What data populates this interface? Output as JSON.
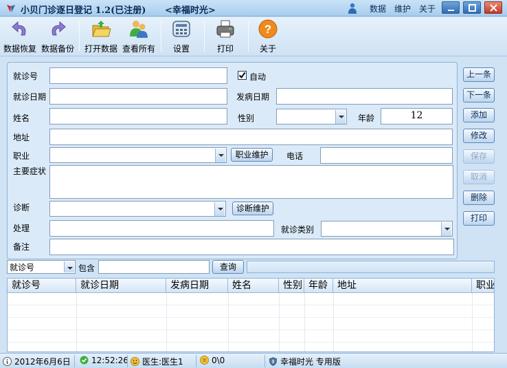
{
  "window": {
    "title": "小贝门诊逐日登记 1.2(已注册)",
    "subtitle": "<幸福时光>",
    "menu": [
      "数据",
      "维护",
      "关于"
    ]
  },
  "toolbar": {
    "restore": "数据恢复",
    "backup": "数据备份",
    "open": "打开数据",
    "view_all": "查看所有",
    "settings": "设置",
    "print": "打印",
    "about": "关于"
  },
  "form": {
    "visit_no_label": "就诊号",
    "visit_no_value": "",
    "auto_label": "自动",
    "auto_checked": true,
    "visit_date_label": "就诊日期",
    "visit_date_value": "",
    "onset_date_label": "发病日期",
    "onset_date_value": "",
    "name_label": "姓名",
    "name_value": "",
    "gender_label": "性别",
    "gender_value": "",
    "age_label": "年龄",
    "age_value": "12",
    "address_label": "地址",
    "address_value": "",
    "job_label": "职业",
    "job_value": "",
    "job_maintain": "职业维护",
    "phone_label": "电话",
    "phone_value": "",
    "symptom_label": "主要症状",
    "symptom_value": "",
    "diagnosis_label": "诊断",
    "diagnosis_value": "",
    "diagnosis_maintain": "诊断维护",
    "treatment_label": "处理",
    "treatment_value": "",
    "visit_type_label": "就诊类别",
    "visit_type_value": "",
    "remark_label": "备注",
    "remark_value": ""
  },
  "actions": {
    "prev": "上一条",
    "next": "下一条",
    "add": "添加",
    "edit": "修改",
    "save": "保存",
    "cancel": "取消",
    "delete": "删除",
    "print": "打印"
  },
  "search": {
    "field": "就诊号",
    "contains_label": "包含",
    "query": "",
    "button": "查询"
  },
  "grid": {
    "columns": [
      "就诊号",
      "就诊日期",
      "发病日期",
      "姓名",
      "性别",
      "年龄",
      "地址",
      "职业"
    ]
  },
  "status": {
    "date": "2012年6月6日",
    "time": "12:52:26",
    "doctor": "医生:医生1",
    "count": "0\\0",
    "edition": "幸福时光 专用版"
  },
  "colors": {
    "window_bg": "#cfe3f5",
    "panel_bg": "#dbeaf8",
    "border": "#8db2d9",
    "title_text": "#0b2a55"
  }
}
